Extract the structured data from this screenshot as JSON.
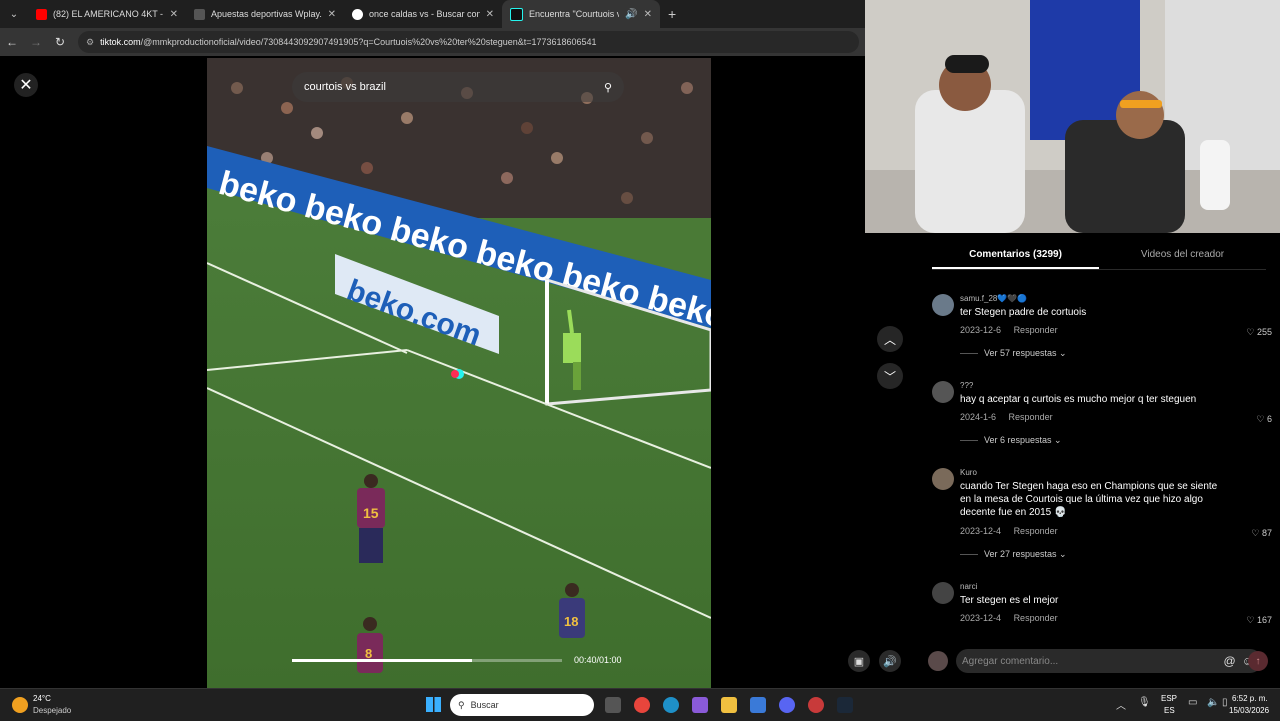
{
  "browser": {
    "tabs": [
      {
        "title": "(82) EL AMERICANO 4KT - KALI",
        "favicon_color": "#ff0000"
      },
      {
        "title": "Apuestas deportivas Wplay.co",
        "favicon_color": "#444444"
      },
      {
        "title": "once caldas vs - Buscar con Go",
        "favicon_color": "#4285f4"
      },
      {
        "title": "Encuentra \"Courtuois vs ter",
        "favicon_color": "#111111"
      }
    ],
    "url_host": "tiktok.com",
    "url_path": "/@mmkproductionoficial/video/7308443092907491905?q=Courtuois%20vs%20ter%20steguen&t=1773618606541"
  },
  "video": {
    "search_placeholder": "courtois vs brazil",
    "time": "00:40/01:00",
    "progress": 0.667,
    "ad_text": "beko.com",
    "board_text": "beko beko beko beko beko beko",
    "player_numbers": [
      "15",
      "18",
      "8"
    ]
  },
  "comments": {
    "tab_comments": "Comentarios (3299)",
    "tab_creator": "Videos del creador",
    "items": [
      {
        "user": "samu.f_28💙🖤🔵",
        "text": "ter Stegen padre de cortuois",
        "date": "2023-12-6",
        "reply": "Responder",
        "likes": "255",
        "replies": "Ver 57 respuestas"
      },
      {
        "user": "???",
        "text": "hay q aceptar q curtois es mucho mejor q ter steguen",
        "date": "2024-1-6",
        "reply": "Responder",
        "likes": "6",
        "replies": "Ver 6 respuestas"
      },
      {
        "user": "Kuro",
        "text": "cuando Ter Stegen haga eso en Champions que se siente en la mesa de Courtois que la última vez que hizo algo decente fue en 2015 💀",
        "date": "2023-12-4",
        "reply": "Responder",
        "likes": "87",
        "replies": "Ver 27 respuestas"
      },
      {
        "user": "narci",
        "text": "Ter stegen es el mejor",
        "date": "2023-12-4",
        "reply": "Responder",
        "likes": "167",
        "replies": ""
      }
    ],
    "composer_placeholder": "Agregar comentario..."
  },
  "taskbar": {
    "temp": "24°C",
    "weather": "Despejado",
    "search": "Buscar",
    "lang1": "ESP",
    "lang2": "ES",
    "time": "6:52 p. m.",
    "date": "15/03/2026"
  }
}
